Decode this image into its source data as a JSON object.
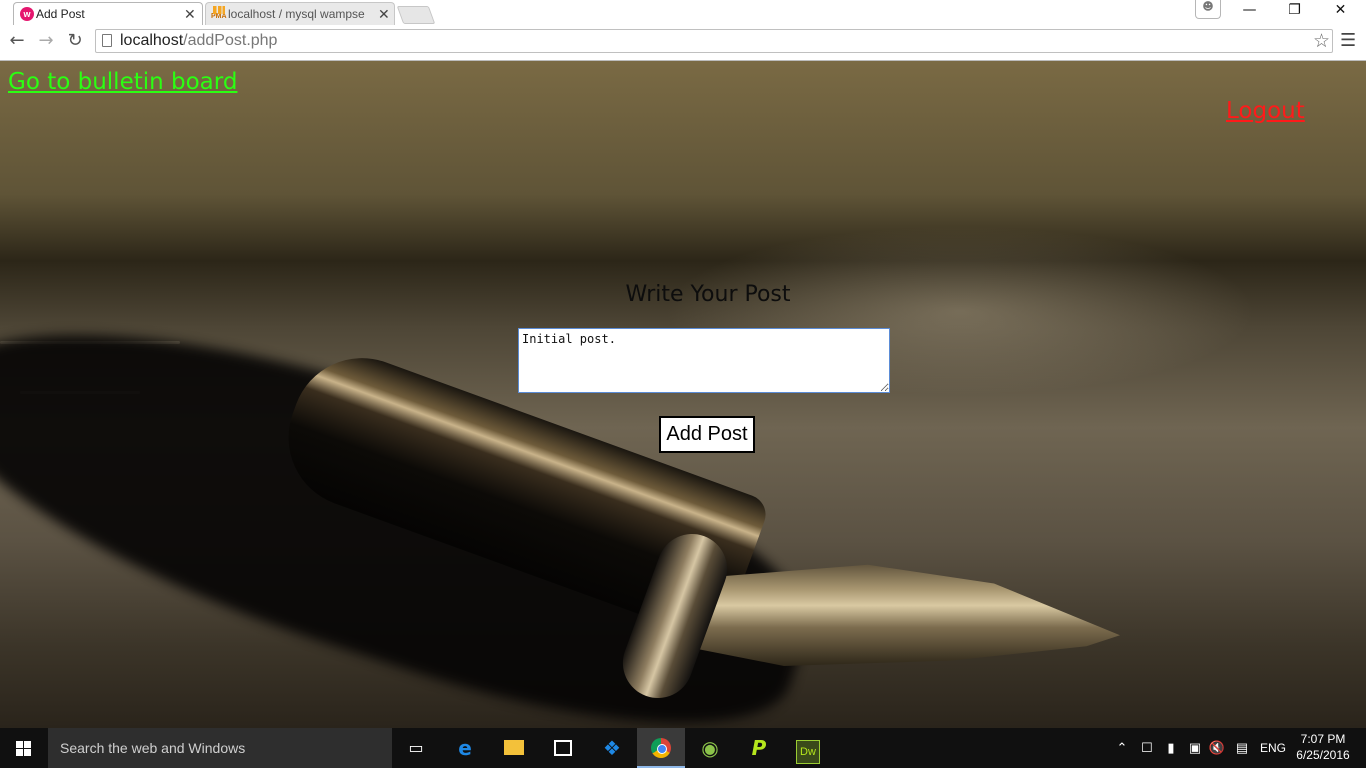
{
  "browser": {
    "tabs": [
      {
        "title": "Add Post",
        "active": true,
        "favicon": "wamp-icon"
      },
      {
        "title": "localhost / mysql wampse",
        "active": false,
        "favicon": "phpmyadmin-icon",
        "favicon_label": "PMA"
      }
    ],
    "address": {
      "host": "localhost",
      "path": "/addPost.php"
    },
    "window_controls": {
      "minimize": "—",
      "restore": "❐",
      "close": "✕"
    }
  },
  "page": {
    "back_link": "Go to bulletin board",
    "logout_link": "Logout",
    "heading": "Write Your Post",
    "post_text": "Initial post.",
    "submit_label": "Add Post",
    "colors": {
      "back_link": "#2bff12",
      "logout_link": "#ff1a1a"
    }
  },
  "taskbar": {
    "search_placeholder": "Search the web and Windows",
    "apps": [
      "task-view",
      "edge",
      "file-explorer",
      "store",
      "dropbox",
      "chrome",
      "android-studio",
      "phpstorm",
      "dreamweaver"
    ],
    "dreamweaver_label": "Dw",
    "language": "ENG",
    "time": "7:07 PM",
    "date": "6/25/2016"
  }
}
